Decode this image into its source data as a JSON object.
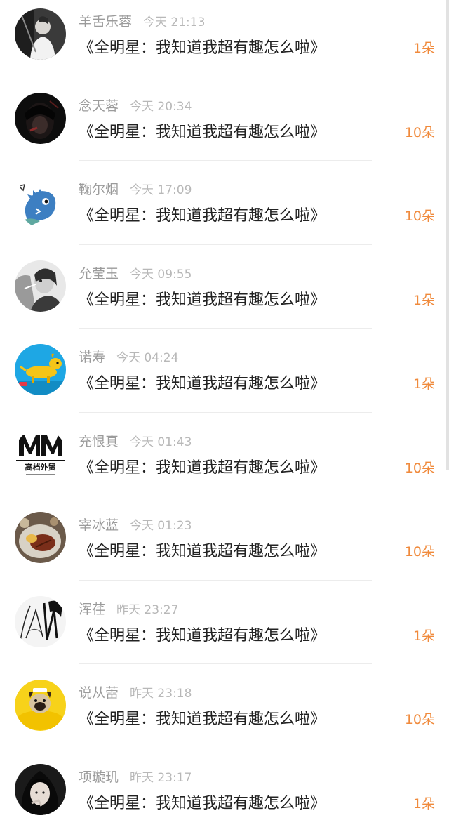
{
  "gift_list": {
    "rows": [
      {
        "user": "羊舌乐蓉",
        "time": "今天 21:13",
        "show": "《全明星：我知道我超有趣怎么啦》",
        "flowers": "1朵",
        "avatar": "avatar-photo-man"
      },
      {
        "user": "念天蓉",
        "time": "今天 20:34",
        "show": "《全明星：我知道我超有趣怎么啦》",
        "flowers": "10朵",
        "avatar": "avatar-photo-dark"
      },
      {
        "user": "鞠尔烟",
        "time": "今天 17:09",
        "show": "《全明星：我知道我超有趣怎么啦》",
        "flowers": "10朵",
        "avatar": "avatar-cartoon-dinosaur"
      },
      {
        "user": "允莹玉",
        "time": "今天 09:55",
        "show": "《全明星：我知道我超有趣怎么啦》",
        "flowers": "1朵",
        "avatar": "avatar-photo-woman"
      },
      {
        "user": "诺寿",
        "time": "今天 04:24",
        "show": "《全明星：我知道我超有趣怎么啦》",
        "flowers": "1朵",
        "avatar": "avatar-cartoon-dog"
      },
      {
        "user": "充恨真",
        "time": "今天 01:43",
        "show": "《全明星：我知道我超有趣怎么啦》",
        "flowers": "10朵",
        "avatar": "avatar-logo-mm",
        "avatar_text": "高档外贸"
      },
      {
        "user": "宰冰蓝",
        "time": "今天 01:23",
        "show": "《全明星：我知道我超有趣怎么啦》",
        "flowers": "10朵",
        "avatar": "avatar-photo-food"
      },
      {
        "user": "浑荏",
        "time": "昨天 23:27",
        "show": "《全明星：我知道我超有趣怎么啦》",
        "flowers": "1朵",
        "avatar": "avatar-sketch"
      },
      {
        "user": "说从蕾",
        "time": "昨天 23:18",
        "show": "《全明星：我知道我超有趣怎么啦》",
        "flowers": "10朵",
        "avatar": "avatar-photo-pug"
      },
      {
        "user": "项璇玑",
        "time": "昨天 23:17",
        "show": "《全明星：我知道我超有趣怎么啦》",
        "flowers": "1朵",
        "avatar": "avatar-photo-girl"
      }
    ]
  },
  "colors": {
    "username": "#9b9b9b",
    "time": "#b8b8b8",
    "title": "#222222",
    "flower_count": "#f08a3c",
    "divider": "#ececec",
    "background": "#ffffff"
  }
}
